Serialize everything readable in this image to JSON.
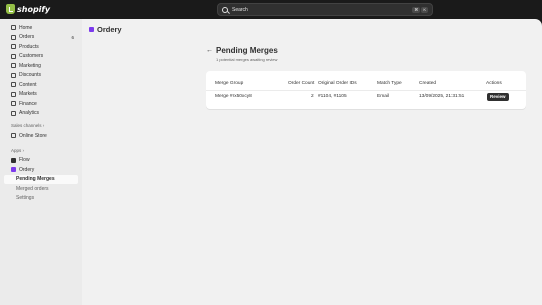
{
  "topbar": {
    "logo_text": "shopify",
    "search_placeholder": "Search",
    "shortcut_keys": [
      "⌘",
      "K"
    ]
  },
  "sidebar": {
    "items": [
      {
        "label": "Home",
        "icon": "home-icon"
      },
      {
        "label": "Orders",
        "icon": "orders-icon",
        "badge": "6"
      },
      {
        "label": "Products",
        "icon": "products-icon"
      },
      {
        "label": "Customers",
        "icon": "customers-icon"
      },
      {
        "label": "Marketing",
        "icon": "marketing-icon"
      },
      {
        "label": "Discounts",
        "icon": "discounts-icon"
      },
      {
        "label": "Content",
        "icon": "content-icon"
      },
      {
        "label": "Markets",
        "icon": "markets-icon"
      },
      {
        "label": "Finance",
        "icon": "finance-icon"
      },
      {
        "label": "Analytics",
        "icon": "analytics-icon"
      }
    ],
    "sales_channels_title": "Sales channels",
    "sales_channels": [
      {
        "label": "Online Store",
        "icon": "store-icon"
      }
    ],
    "apps_title": "Apps",
    "apps": [
      {
        "label": "Flow",
        "icon": "flow-icon"
      },
      {
        "label": "Ordery",
        "icon": "ordery-icon"
      }
    ],
    "ordery_subitems": [
      {
        "label": "Pending Merges",
        "active": true
      },
      {
        "label": "Merged orders",
        "active": false
      },
      {
        "label": "Settings",
        "active": false
      }
    ]
  },
  "app_header": {
    "title": "Ordery"
  },
  "page": {
    "title": "Pending Merges",
    "subtitle": "1 potential merges awaiting review"
  },
  "table": {
    "headers": [
      "Merge Group",
      "Order Count",
      "Original Order IDs",
      "Match Type",
      "Created",
      "Actions"
    ],
    "rows": [
      {
        "merge_group": "Merge #rx50xcy8",
        "order_count": "2",
        "order_ids": "#1104, #1105",
        "match_type": "Email",
        "created": "13/09/2025, 21:31:51",
        "action_label": "Review"
      }
    ]
  },
  "colors": {
    "topbar": "#1a1a1a",
    "sidebar": "#ebebeb",
    "content": "#f1f1f1",
    "primary_button": "#303030",
    "shopify_green": "#95bf47",
    "ordery_purple": "#7c3aed"
  }
}
